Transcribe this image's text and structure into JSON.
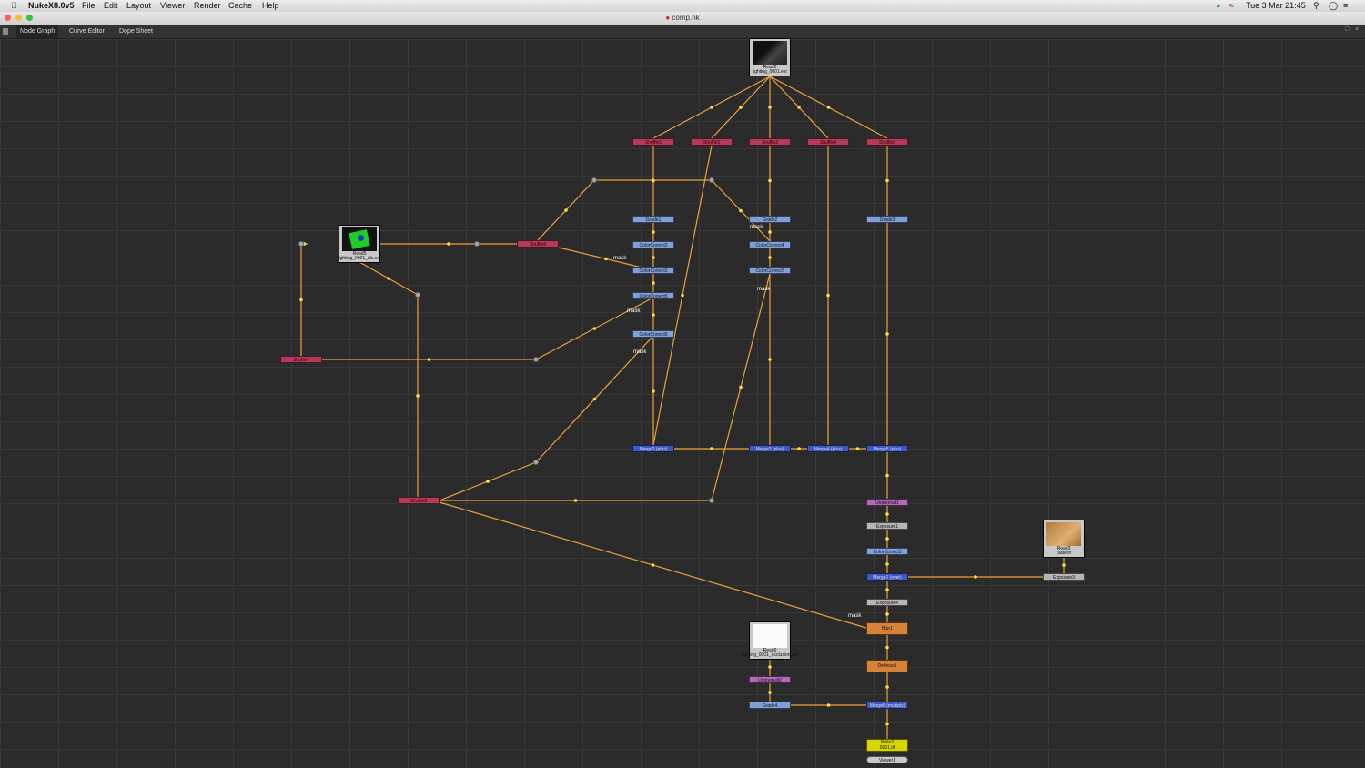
{
  "menubar": {
    "app": "NukeX8.0v5",
    "menus": [
      "File",
      "Edit",
      "Layout",
      "Viewer",
      "Render",
      "Cache",
      "Help"
    ],
    "clock": "Tue 3 Mar  21:45"
  },
  "window": {
    "title": "comp.nk"
  },
  "tabs": [
    "Node Graph",
    "Curve Editor",
    "Dope Sheet"
  ],
  "colors": {
    "edge": "#e8a23a",
    "dot": "#f5e04a",
    "shuffle": "#b33a5a",
    "grade": "#7f9fd8",
    "merge": "#3f59c4",
    "exposure": "#b5b5b5",
    "blur": "#d68238",
    "write": "#d8d600"
  },
  "nodes": {
    "read2": "Read2",
    "read2_file": "lighting_0001.exr",
    "read5": "Read5",
    "read5_file": "lighting_0001_ids.exr",
    "read3": "Read3",
    "read3_file": "plate.tif",
    "read6": "Read6",
    "read6_file": "lighting_0001_occlusion.exr",
    "shuffle1": "Shuffle1",
    "shuffle2": "Shuffle2",
    "shuffle3": "Shuffle3",
    "shuffle4": "Shuffle4",
    "shuffle5": "Shuffle5",
    "shuffle6": "Shuffle6",
    "shuffle7": "Shuffle7",
    "shuffle8": "Shuffle8",
    "grade1": "Grade1",
    "grade2": "Grade2",
    "grade3": "Grade3",
    "grade4": "Grade4",
    "cc2": "ColorCorrect2",
    "cc3": "ColorCorrect3",
    "cc5": "ColorCorrect5",
    "cc6": "ColorCorrect6",
    "cc4": "ColorCorrect4",
    "cc7": "ColorCorrect7",
    "cc1": "ColorCorrect1",
    "merge2": "Merge2 (plus)",
    "merge3": "Merge3 (plus)",
    "merge4": "Merge4 (plus)",
    "merge5": "Merge5 (plus)",
    "unpremult1": "Unpremult1",
    "exposure1": "Exposure1",
    "exposure3": "Exposure3",
    "merge1": "Merge1 (over)",
    "exposure4": "Exposure4",
    "blur1": "Blur1",
    "defocus1": "Defocus1",
    "unpremult2": "Unpremult2",
    "merge6": "Merge6 (multiply)",
    "write2": "Write2",
    "write2_file": "0001.tif",
    "viewer1": "Viewer1"
  },
  "mask_label": "mask"
}
